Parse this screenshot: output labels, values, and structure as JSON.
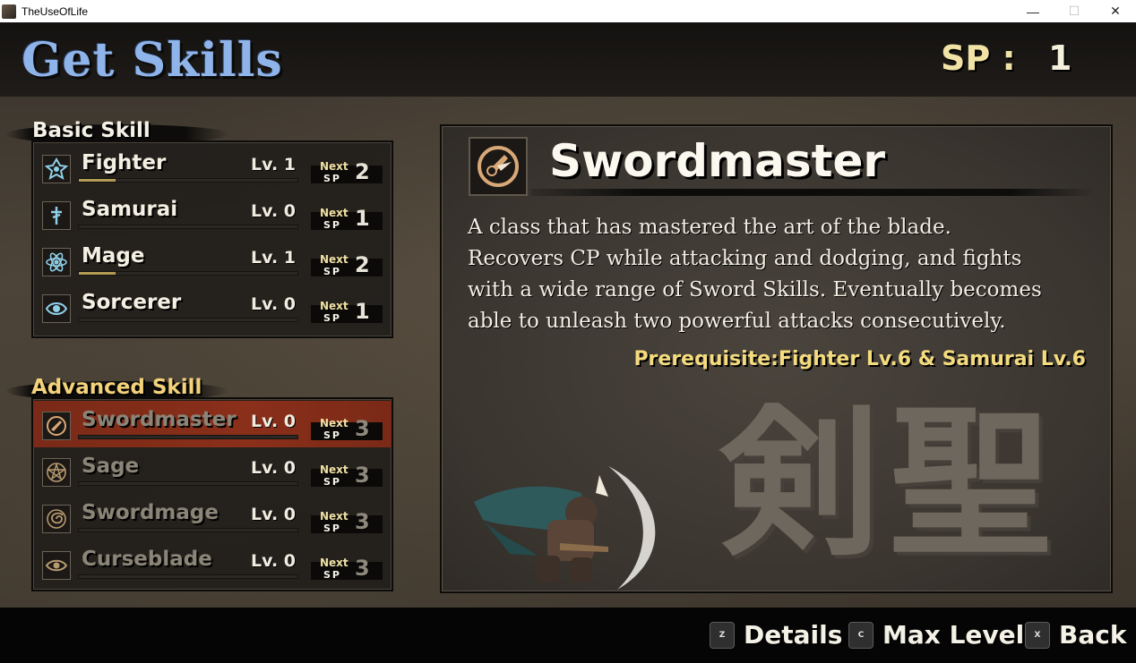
{
  "window": {
    "title": "TheUseOfLife",
    "minimize_glyph": "—",
    "maximize_glyph": "☐",
    "close_glyph": "✕"
  },
  "header": {
    "title": "Get Skills",
    "sp_label": "SP :",
    "sp_value": "1"
  },
  "basic": {
    "heading": "Basic Skill",
    "items": [
      {
        "name": "Fighter",
        "level": "Lv. 1",
        "next": "Next",
        "sp": "SP",
        "cost": "2",
        "progress": 0.17,
        "icon": "fighter-crest-icon",
        "locked": false
      },
      {
        "name": "Samurai",
        "level": "Lv. 0",
        "next": "Next",
        "sp": "SP",
        "cost": "1",
        "progress": 0,
        "icon": "samurai-glyph-icon",
        "locked": false
      },
      {
        "name": "Mage",
        "level": "Lv. 1",
        "next": "Next",
        "sp": "SP",
        "cost": "2",
        "progress": 0.17,
        "icon": "atom-icon",
        "locked": false
      },
      {
        "name": "Sorcerer",
        "level": "Lv. 0",
        "next": "Next",
        "sp": "SP",
        "cost": "1",
        "progress": 0,
        "icon": "eye-icon",
        "locked": false
      }
    ]
  },
  "advanced": {
    "heading": "Advanced Skill",
    "items": [
      {
        "name": "Swordmaster",
        "level": "Lv. 0",
        "next": "Next",
        "sp": "SP",
        "cost": "3",
        "progress": 0,
        "icon": "swordmaster-crest-icon",
        "locked": true,
        "selected": true
      },
      {
        "name": "Sage",
        "level": "Lv. 0",
        "next": "Next",
        "sp": "SP",
        "cost": "3",
        "progress": 0,
        "icon": "pentagram-icon",
        "locked": true
      },
      {
        "name": "Swordmage",
        "level": "Lv. 0",
        "next": "Next",
        "sp": "SP",
        "cost": "3",
        "progress": 0,
        "icon": "swirl-icon",
        "locked": true
      },
      {
        "name": "Curseblade",
        "level": "Lv. 0",
        "next": "Next",
        "sp": "SP",
        "cost": "3",
        "progress": 0,
        "icon": "curse-eye-icon",
        "locked": true
      }
    ]
  },
  "detail": {
    "title": "Swordmaster",
    "description": [
      "A class that has mastered the art of the blade.",
      "Recovers CP while attacking and dodging, and fights",
      "with a wide range of Sword Skills. Eventually becomes",
      "able to unleash two powerful attacks consecutively."
    ],
    "prerequisite": "Prerequisite:Fighter Lv.6 & Samurai Lv.6",
    "kanji": "剣聖"
  },
  "footer": {
    "buttons": [
      {
        "key": "Z",
        "label": "Details"
      },
      {
        "key": "C",
        "label": "Max Level"
      },
      {
        "key": "X",
        "label": "Back"
      }
    ]
  },
  "colors": {
    "title_blue": "#8fb4ea",
    "basic_heading": "#f4f1e6",
    "advanced_heading": "#f3d27a",
    "selected_row": "#8a2f1a",
    "prereq": "#f3db7e"
  }
}
